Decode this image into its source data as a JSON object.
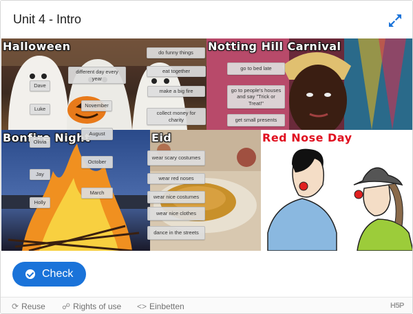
{
  "header": {
    "title": "Unit 4 - Intro",
    "fullscreen_icon": "expand-arrows-icon"
  },
  "panels": {
    "halloween": {
      "title": "Halloween"
    },
    "notting_hill": {
      "title": "Notting Hill Carnival"
    },
    "bonfire": {
      "title": "Bonfire Night"
    },
    "eid": {
      "title": "Eid"
    },
    "red_nose": {
      "title": "Red Nose Day"
    }
  },
  "draggables": [
    "do funny things",
    "different day every year",
    "eat together",
    "Dave",
    "make a big fire",
    "November",
    "Luke",
    "collect money for charity",
    "go to bed late",
    "go to people's houses and say \"Trick or Treat!\"",
    "get small presents",
    "August",
    "Olivia",
    "October",
    "Jay",
    "March",
    "Holly",
    "wear scary costumes",
    "wear red noses",
    "wear nice costumes",
    "wear nice clothes",
    "dance in the streets"
  ],
  "check_button": {
    "label": "Check",
    "icon": "check-circle-icon"
  },
  "footer": {
    "reuse": "Reuse",
    "rights": "Rights of use",
    "embed": "Einbetten",
    "logo": "H5P"
  },
  "colors": {
    "accent": "#1a73d9",
    "red_title": "#e01020"
  }
}
